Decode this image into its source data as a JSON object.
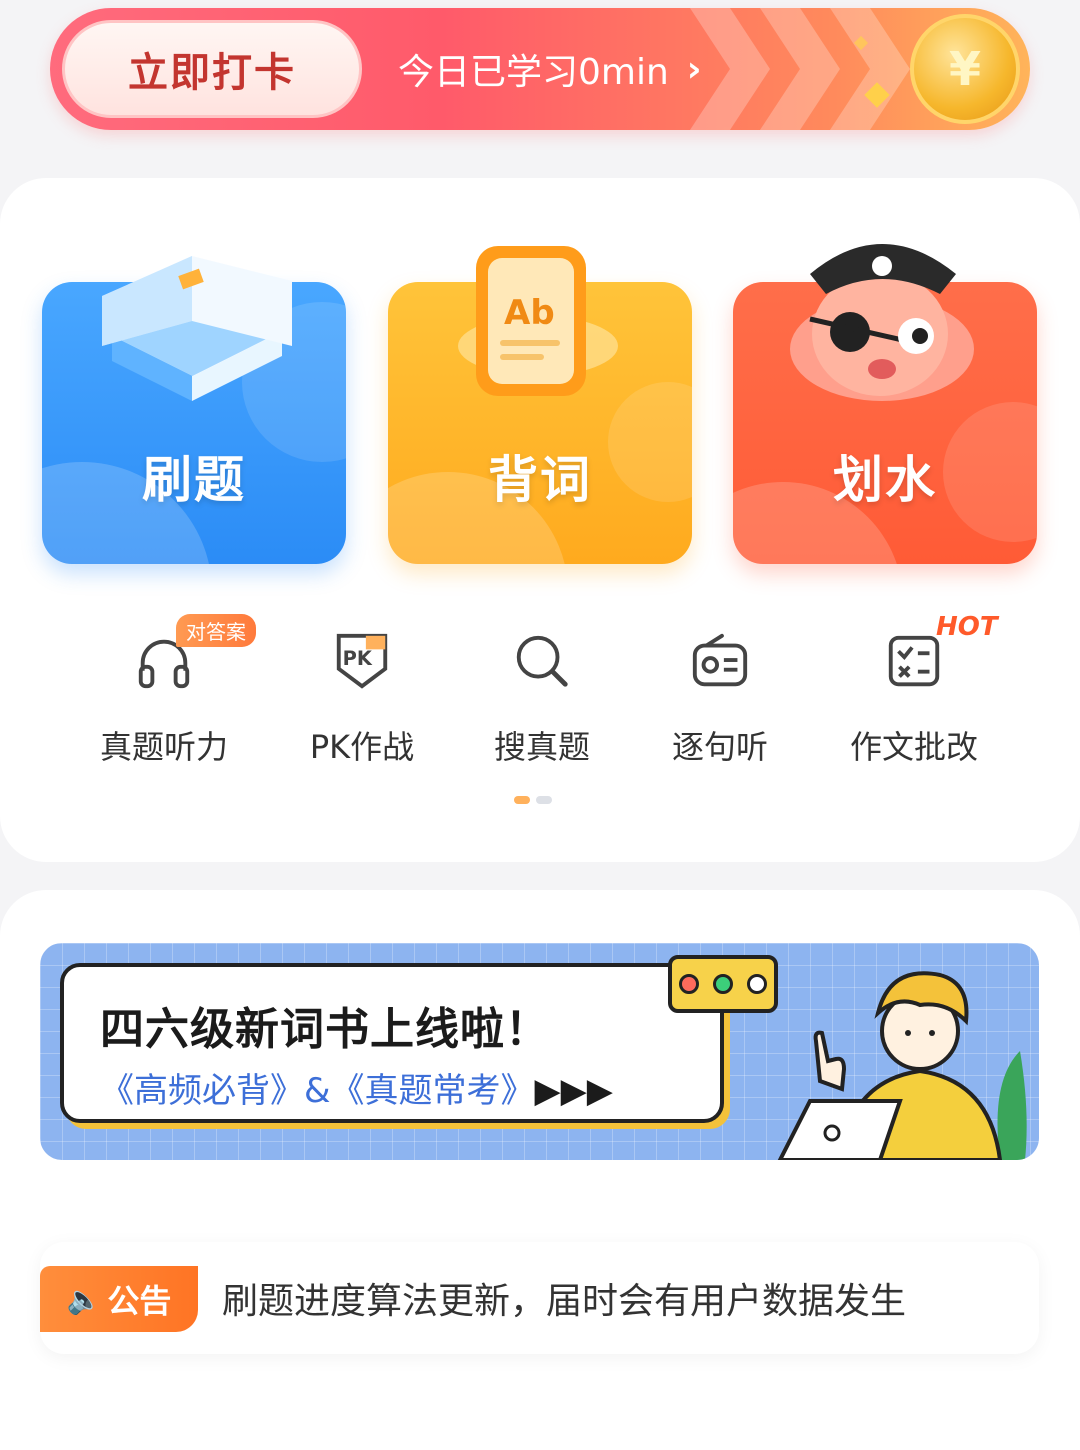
{
  "signin": {
    "button_label": "立即打卡",
    "studied_text": "今日已学习0min",
    "chevron": "›",
    "coin_symbol": "¥"
  },
  "tiles": [
    {
      "label": "刷题",
      "icon": "book-icon",
      "color": "#2b8cf6"
    },
    {
      "label": "背词",
      "icon": "word-card-icon",
      "color": "#ffaa1e"
    },
    {
      "label": "划水",
      "icon": "pirate-octopus-icon",
      "color": "#ff5b36"
    }
  ],
  "quick_actions": [
    {
      "label": "真题听力",
      "icon": "headphones-icon",
      "badge": "对答案"
    },
    {
      "label": "PK作战",
      "icon": "pk-shield-icon"
    },
    {
      "label": "搜真题",
      "icon": "search-icon"
    },
    {
      "label": "逐句听",
      "icon": "radio-icon"
    },
    {
      "label": "作文批改",
      "icon": "checklist-icon",
      "badge": "HOT"
    }
  ],
  "pager": {
    "pages": 2,
    "current": 1
  },
  "promo": {
    "title": "四六级新词书上线啦！",
    "subtitle": "《高频必背》&《真题常考》",
    "arrow": "▶▶▶"
  },
  "notice": {
    "tag": "公告",
    "text": "刷题进度算法更新，届时会有用户数据发生"
  },
  "colors": {
    "accent_orange": "#ff7a3c",
    "banner_red": "#ff5a6a",
    "promo_blue": "#8db4f0"
  }
}
